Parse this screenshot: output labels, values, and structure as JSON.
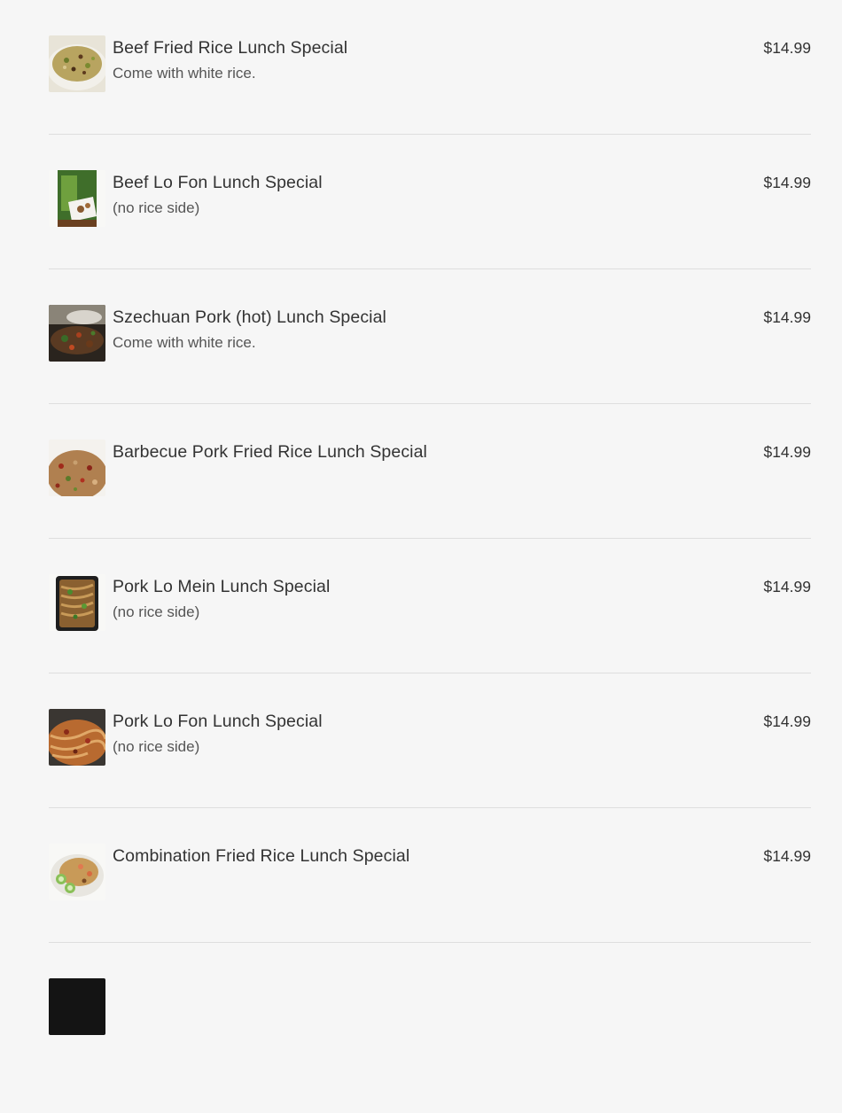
{
  "menu": {
    "items": [
      {
        "name": "Beef Fried Rice Lunch Special",
        "description": "Come with white rice.",
        "price": "$14.99",
        "image_icon": "beef-fried-rice-image"
      },
      {
        "name": "Beef Lo Fon Lunch Special",
        "description": "(no rice side)",
        "price": "$14.99",
        "image_icon": "beef-lo-fon-image"
      },
      {
        "name": "Szechuan Pork (hot) Lunch Special",
        "description": "Come with white rice.",
        "price": "$14.99",
        "image_icon": "szechuan-pork-image"
      },
      {
        "name": "Barbecue Pork Fried Rice Lunch Special",
        "description": "",
        "price": "$14.99",
        "image_icon": "bbq-pork-fried-rice-image"
      },
      {
        "name": "Pork Lo Mein Lunch Special",
        "description": "(no rice side)",
        "price": "$14.99",
        "image_icon": "pork-lo-mein-image"
      },
      {
        "name": "Pork Lo Fon Lunch Special",
        "description": "(no rice side)",
        "price": "$14.99",
        "image_icon": "pork-lo-fon-image"
      },
      {
        "name": "Combination Fried Rice Lunch Special",
        "description": "",
        "price": "$14.99",
        "image_icon": "combination-fried-rice-image"
      }
    ]
  },
  "colors": {
    "background": "#f6f6f6",
    "text": "#333333",
    "divider": "#dedede"
  }
}
